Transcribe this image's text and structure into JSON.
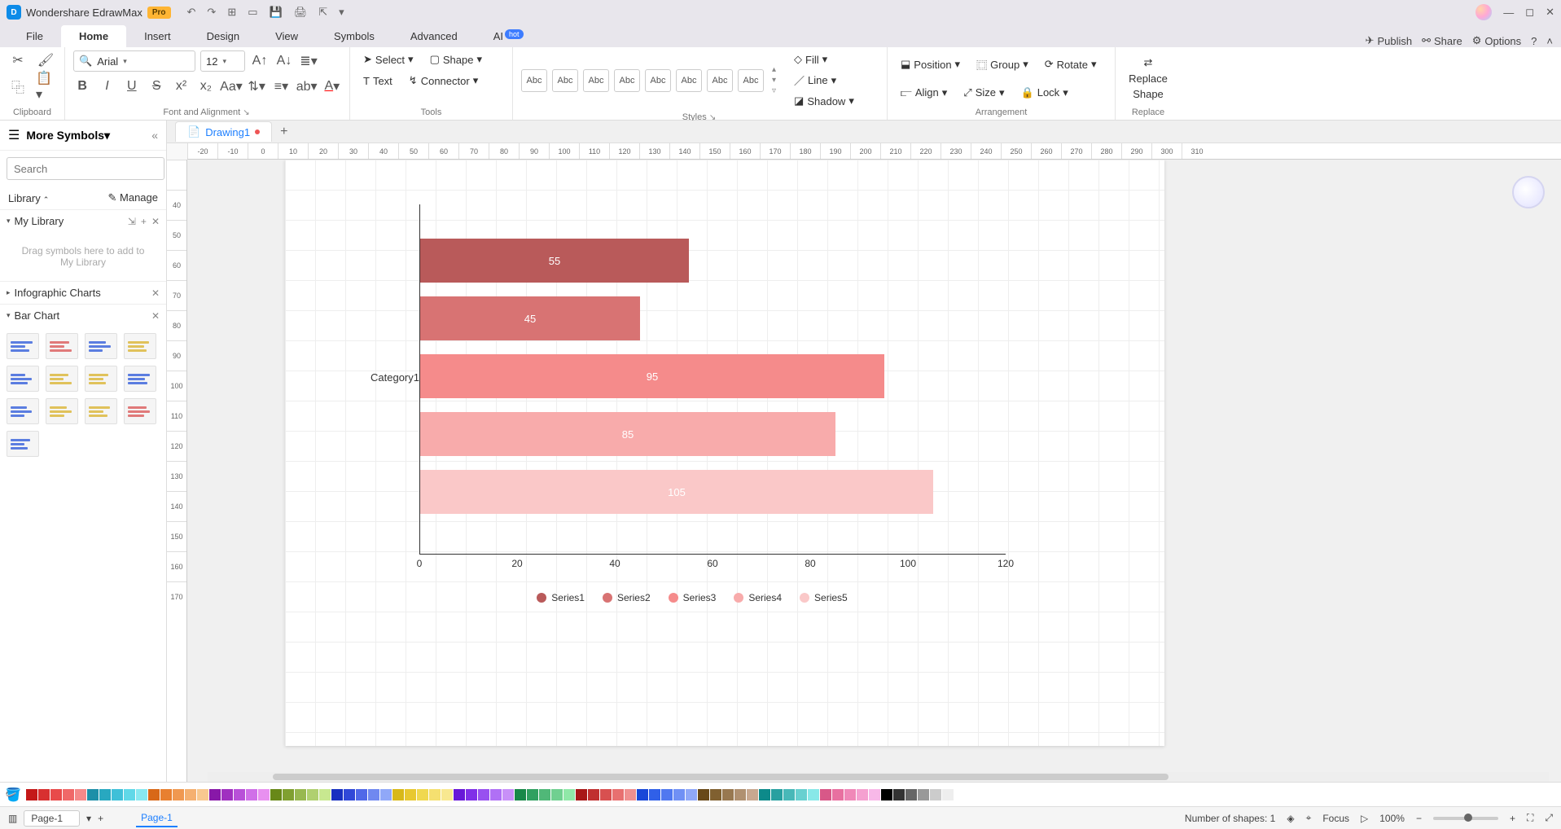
{
  "app": {
    "title": "Wondershare EdrawMax",
    "pro": "Pro"
  },
  "menu": {
    "items": [
      "File",
      "Home",
      "Insert",
      "Design",
      "View",
      "Symbols",
      "Advanced",
      "AI"
    ],
    "active": "Home",
    "ai_badge": "hot",
    "right": {
      "publish": "Publish",
      "share": "Share",
      "options": "Options"
    }
  },
  "ribbon": {
    "clipboard": {
      "label": "Clipboard"
    },
    "font": {
      "family": "Arial",
      "size": "12",
      "label": "Font and Alignment"
    },
    "tools": {
      "select": "Select",
      "shape": "Shape",
      "text": "Text",
      "connector": "Connector",
      "label": "Tools"
    },
    "styles": {
      "swatch_text": "Abc",
      "fill": "Fill",
      "line": "Line",
      "shadow": "Shadow",
      "label": "Styles"
    },
    "arrange": {
      "position": "Position",
      "group": "Group",
      "rotate": "Rotate",
      "align": "Align",
      "size": "Size",
      "lock": "Lock",
      "label": "Arrangement"
    },
    "replace": {
      "replace": "Replace",
      "shape": "Shape",
      "label": "Replace"
    }
  },
  "sidebar": {
    "title": "More Symbols",
    "search_placeholder": "Search",
    "search_btn": "Search",
    "library": "Library",
    "manage": "Manage",
    "mylib": "My Library",
    "drop_hint": "Drag symbols here to add to My Library",
    "sections": {
      "infographic": "Infographic Charts",
      "barchart": "Bar Chart"
    }
  },
  "document": {
    "tab": "Drawing1"
  },
  "ruler_h": [
    "-20",
    "-10",
    "0",
    "10",
    "20",
    "30",
    "40",
    "50",
    "60",
    "70",
    "80",
    "90",
    "100",
    "110",
    "120",
    "130",
    "140",
    "150",
    "160",
    "170",
    "180",
    "190",
    "200",
    "210",
    "220",
    "230",
    "240",
    "250",
    "260",
    "270",
    "280",
    "290",
    "300",
    "310"
  ],
  "ruler_v": [
    "",
    "40",
    "50",
    "60",
    "70",
    "80",
    "90",
    "100",
    "110",
    "120",
    "130",
    "140",
    "150",
    "160",
    "170"
  ],
  "chart_data": {
    "type": "bar",
    "orientation": "horizontal",
    "ylabel": "Category1",
    "categories": [
      "Series1",
      "Series2",
      "Series3",
      "Series4",
      "Series5"
    ],
    "values": [
      55,
      45,
      95,
      85,
      105
    ],
    "colors": [
      "#b95a5a",
      "#d87373",
      "#f58b8b",
      "#f8abab",
      "#fac8c8"
    ],
    "xlim": [
      0,
      120
    ],
    "xticks": [
      0,
      20,
      40,
      60,
      80,
      100,
      120
    ],
    "legend": [
      "Series1",
      "Series2",
      "Series3",
      "Series4",
      "Series5"
    ]
  },
  "status": {
    "page_selector": "Page-1",
    "page_tab": "Page-1",
    "shapes": "Number of shapes: 1",
    "focus": "Focus",
    "zoom": "100%"
  },
  "palette": [
    "#c41919",
    "#d83030",
    "#e84a4a",
    "#f06868",
    "#f58989",
    "#1d8fa8",
    "#28a8c0",
    "#3fc0d8",
    "#60d8e8",
    "#88e8f0",
    "#d86818",
    "#e88030",
    "#f09850",
    "#f5b070",
    "#f8c890",
    "#8818a8",
    "#a030c0",
    "#b850d8",
    "#d070e8",
    "#e890f0",
    "#688818",
    "#80a030",
    "#98b850",
    "#b0d070",
    "#c8e890",
    "#1830c0",
    "#3048d8",
    "#5068e8",
    "#7088f0",
    "#90a8f8",
    "#d8b818",
    "#e8c830",
    "#f0d850",
    "#f5e070",
    "#f8e890",
    "#6818d8",
    "#8030e8",
    "#9850f0",
    "#b070f5",
    "#c890f8",
    "#188848",
    "#30a060",
    "#50b878",
    "#70d090",
    "#90e8a8",
    "#a81818",
    "#c03030",
    "#d85050",
    "#e87070",
    "#f09090",
    "#1848d8",
    "#3060e8",
    "#5078f0",
    "#7090f5",
    "#90a8f8",
    "#684818",
    "#806030",
    "#987850",
    "#b09070",
    "#c8a890",
    "#0d8a8a",
    "#28a0a0",
    "#48b8b8",
    "#68d0d0",
    "#88e8e8",
    "#d85888",
    "#e870a0",
    "#f088b8",
    "#f5a0d0",
    "#f8b8e8",
    "#000000",
    "#333333",
    "#666666",
    "#999999",
    "#cccccc",
    "#eeeeee",
    "#ffffff"
  ]
}
